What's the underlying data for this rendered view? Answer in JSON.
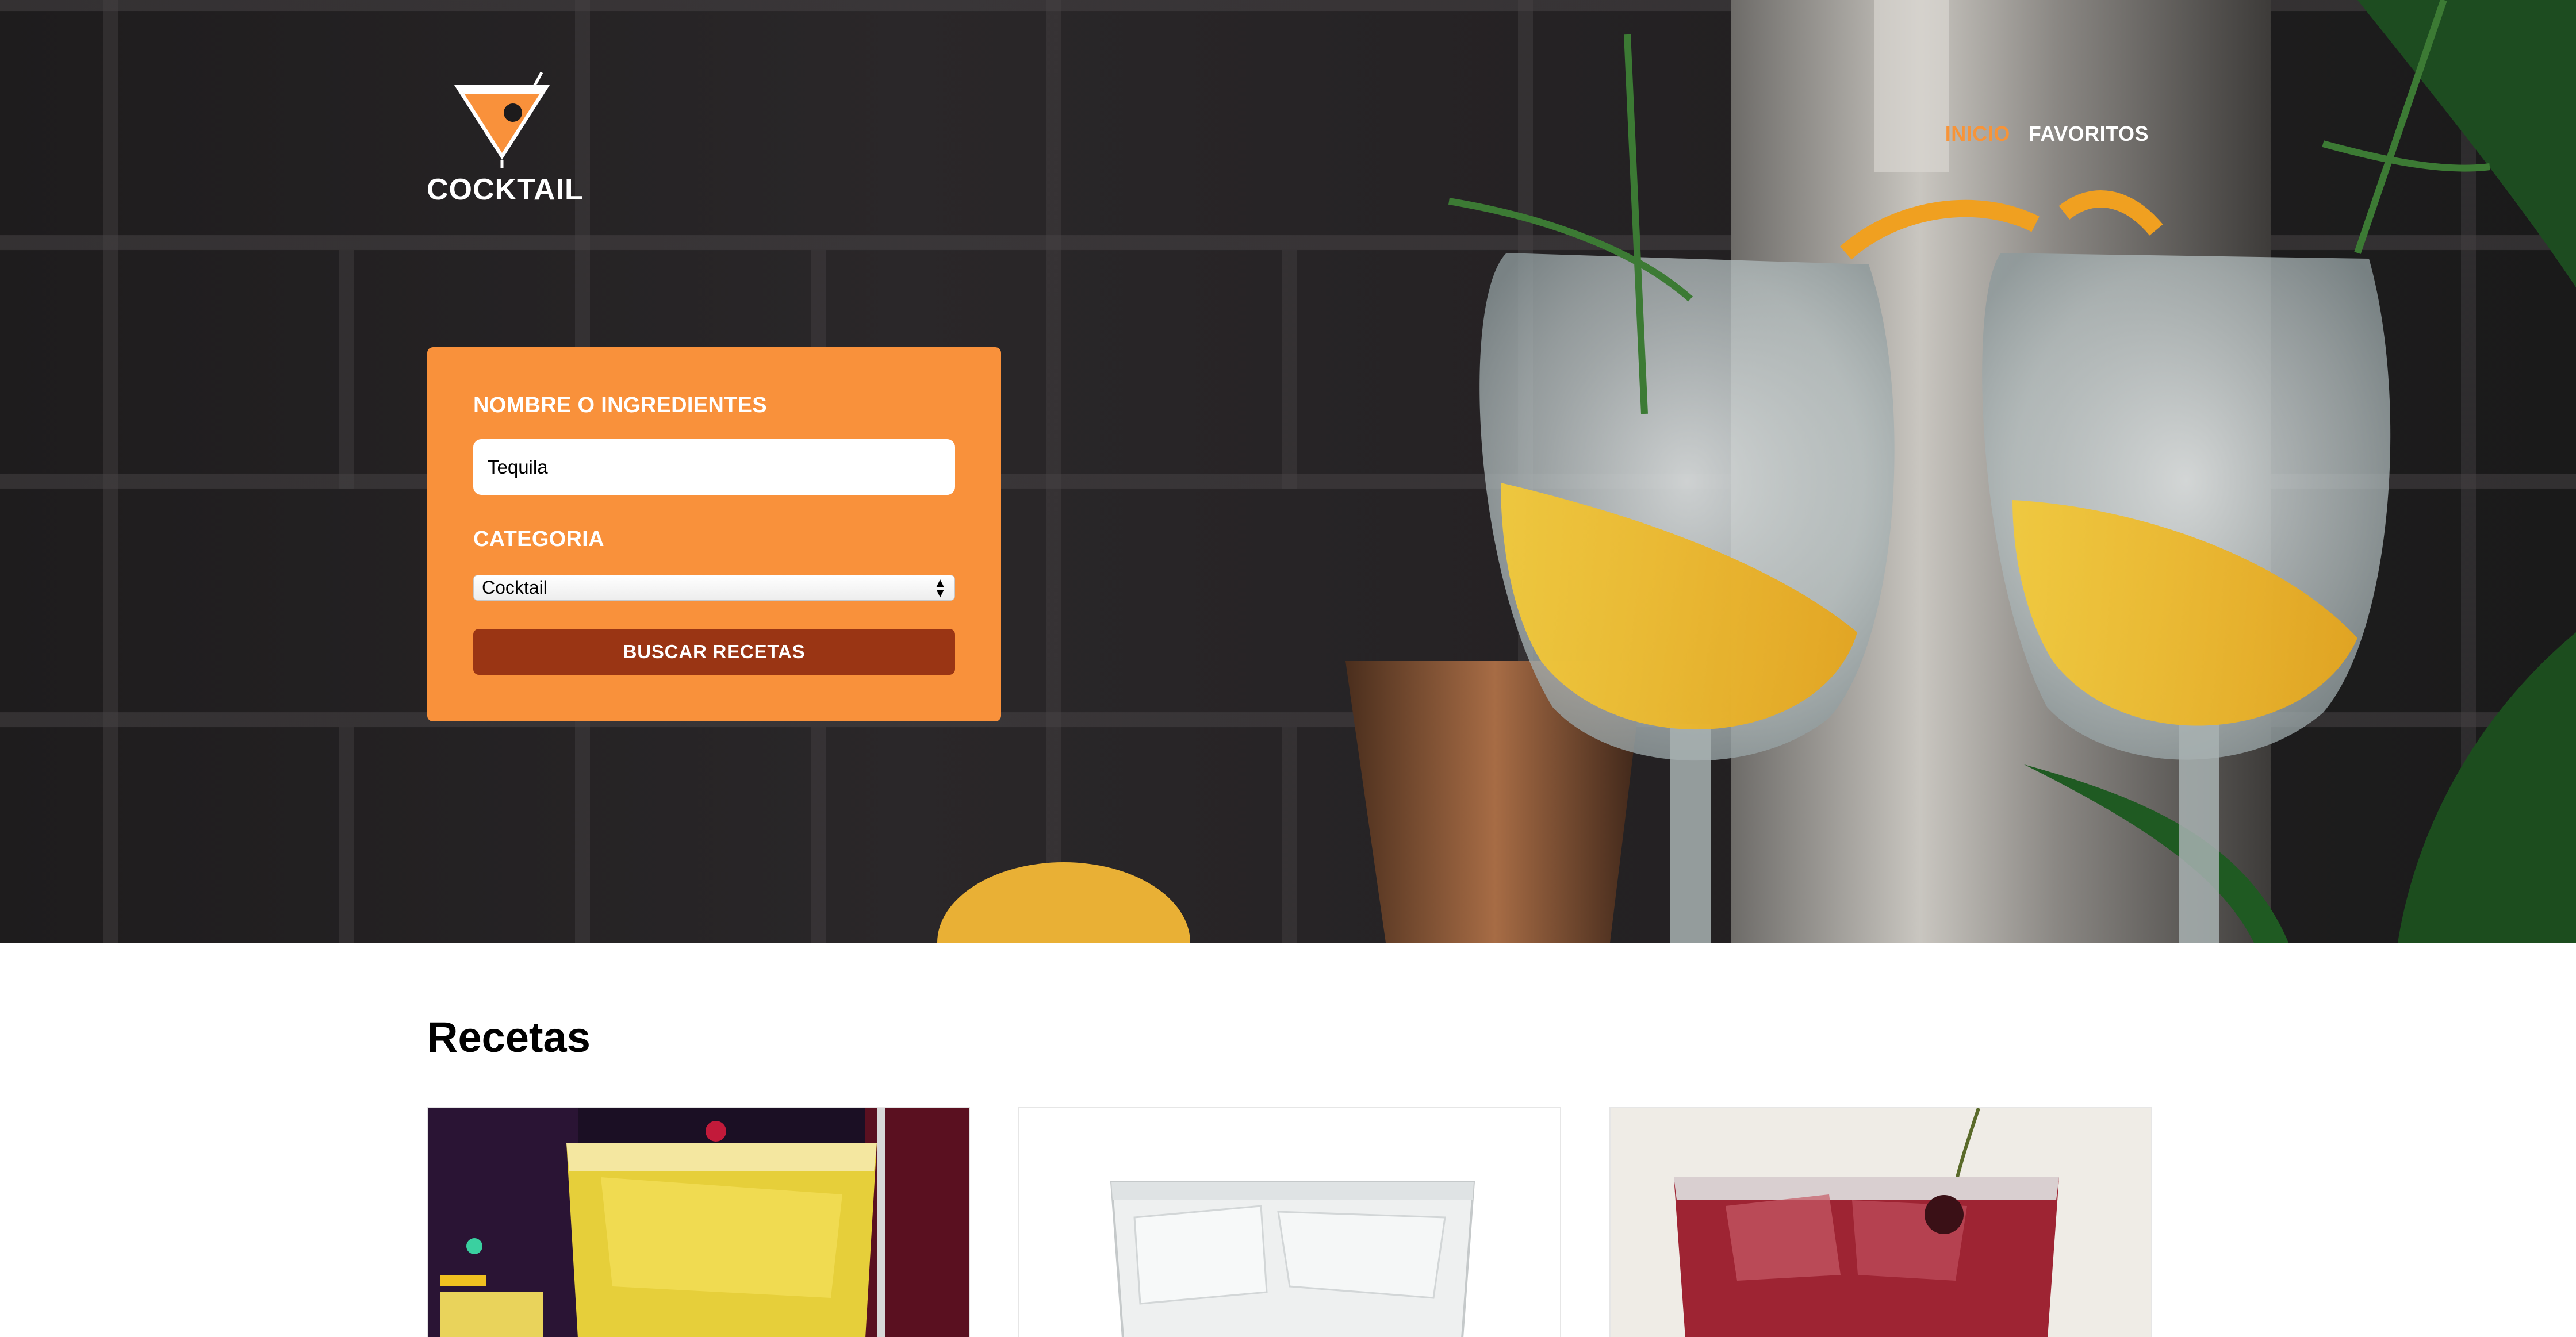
{
  "brand": {
    "name": "COCKTAIL",
    "logo_icon": "martini-glass-icon"
  },
  "nav": {
    "items": [
      {
        "label": "INICIO",
        "active": true
      },
      {
        "label": "FAVORITOS",
        "active": false
      }
    ]
  },
  "search_form": {
    "name_label": "NOMBRE O INGREDIENTES",
    "name_value": "Tequila",
    "category_label": "CATEGORIA",
    "category_selected": "Cocktail",
    "submit_label": "BUSCAR RECETAS"
  },
  "recipes": {
    "title": "Recetas",
    "cards": [
      {
        "image": "yellow-cocktail-photo"
      },
      {
        "image": "clear-cocktail-photo"
      },
      {
        "image": "red-cocktail-photo"
      }
    ]
  },
  "colors": {
    "accent_orange": "#f9913b",
    "nav_active": "#f79439",
    "button_brown": "#9a3514"
  }
}
